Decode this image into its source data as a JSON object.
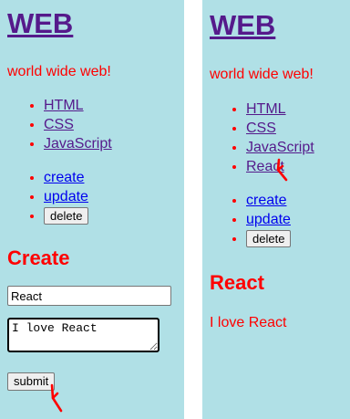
{
  "left_panel": {
    "site_title": "WEB",
    "subtitle": "world wide web!",
    "nav_items": [
      {
        "label": "HTML"
      },
      {
        "label": "CSS"
      },
      {
        "label": "JavaScript"
      }
    ],
    "controls": {
      "create_label": "create",
      "update_label": "update",
      "delete_label": "delete"
    },
    "form": {
      "heading": "Create",
      "title_value": "React",
      "body_value": "I love React",
      "submit_label": "submit"
    }
  },
  "right_panel": {
    "site_title": "WEB",
    "subtitle": "world wide web!",
    "nav_items": [
      {
        "label": "HTML"
      },
      {
        "label": "CSS"
      },
      {
        "label": "JavaScript"
      },
      {
        "label": "React"
      }
    ],
    "controls": {
      "create_label": "create",
      "update_label": "update",
      "delete_label": "delete"
    },
    "article": {
      "heading": "React",
      "body": "I love React"
    }
  },
  "colors": {
    "panel_background": "#b0e0e6",
    "accent_red": "#ff0000",
    "visited_link": "#551a8b",
    "unvisited_link": "#0000ee",
    "annotation_mark": "#ff0000"
  },
  "icons": {
    "annotation": "red-hand-drawn-cursor-icon"
  }
}
